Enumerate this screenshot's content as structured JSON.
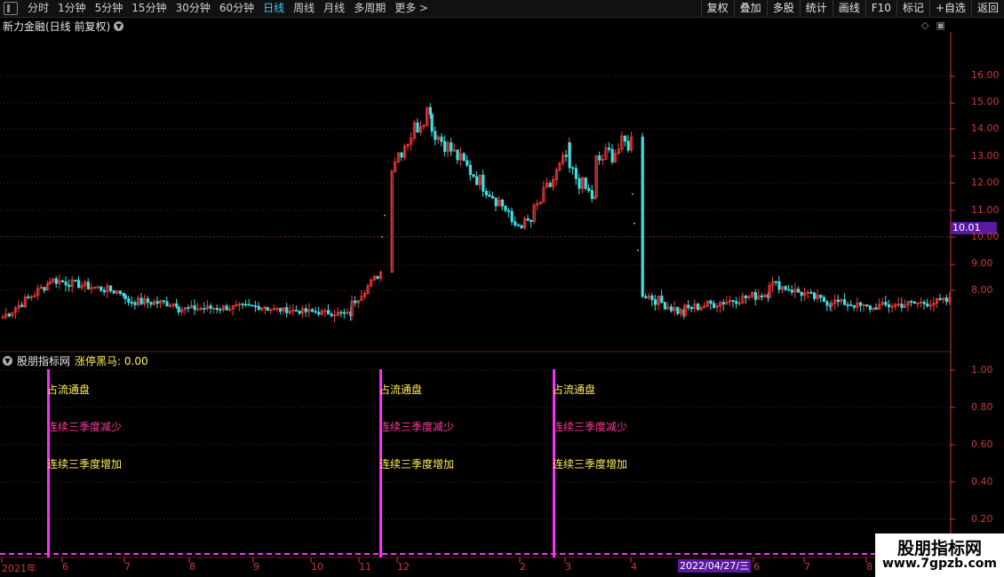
{
  "toolbar": {
    "periods": [
      "分时",
      "1分钟",
      "5分钟",
      "15分钟",
      "30分钟",
      "60分钟",
      "日线",
      "周线",
      "月线",
      "多周期",
      "更多 >"
    ],
    "active_period": "日线",
    "buttons": [
      "复权",
      "叠加",
      "多股",
      "统计",
      "画线",
      "F10",
      "标记",
      "+自选",
      "返回"
    ]
  },
  "chart": {
    "title": "新力金融(日线 前复权)",
    "current_price": "10.01",
    "y_ticks": [
      "16.00",
      "15.00",
      "14.00",
      "13.00",
      "12.00",
      "11.00",
      "10.00",
      "9.00",
      "8.00"
    ],
    "indicator_y_ticks": [
      "1.00",
      "0.80",
      "0.60",
      "0.40",
      "0.20"
    ],
    "x_ticks": [
      "2021年",
      "6",
      "7",
      "8",
      "9",
      "10",
      "11",
      "12",
      "2",
      "3",
      "4",
      "6",
      "7",
      "8"
    ],
    "cursor_date": "2022/04/27/三"
  },
  "indicator": {
    "name": "股朋指标网",
    "value_label": "涨停黑马: 0.00",
    "signals": [
      {
        "l1": "占流通盘",
        "l2": "连续三季度减少",
        "l3": "连续三季度增加"
      },
      {
        "l1": "占流通盘",
        "l2": "连续三季度减少",
        "l3": "连续三季度增加"
      },
      {
        "l1": "占流通盘",
        "l2": "连续三季度减少",
        "l3": "连续三季度增加"
      }
    ]
  },
  "watermark": {
    "title": "股朋指标网",
    "url": "www.7gpzb.com"
  },
  "colors": {
    "up": "#ff3b3b",
    "down": "#3fe0e0",
    "signal": "#ff2bff",
    "axis": "#c83a3a",
    "grid": "#6a1a1a"
  }
}
